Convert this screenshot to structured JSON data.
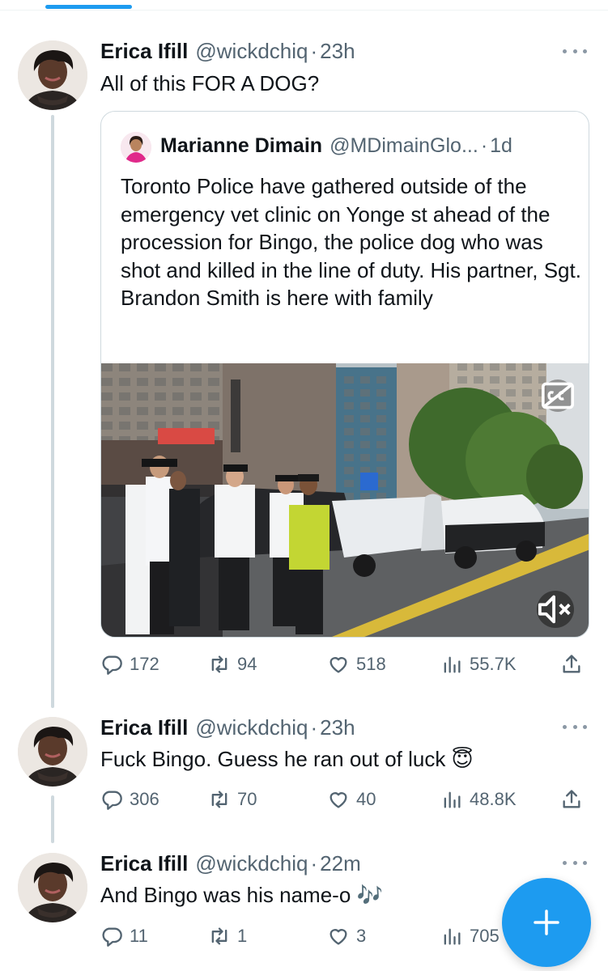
{
  "tweets": [
    {
      "name": "Erica Ifill",
      "handle": "@wickdchiq",
      "time": "23h",
      "text": "All of this FOR A DOG?",
      "stats": {
        "replies": "172",
        "retweets": "94",
        "likes": "518",
        "views": "55.7K"
      }
    },
    {
      "name": "Erica Ifill",
      "handle": "@wickdchiq",
      "time": "23h",
      "text": "Fuck Bingo. Guess he ran out of luck 😇",
      "stats": {
        "replies": "306",
        "retweets": "70",
        "likes": "40",
        "views": "48.8K"
      }
    },
    {
      "name": "Erica Ifill",
      "handle": "@wickdchiq",
      "time": "22m",
      "text": "And Bingo was his name-o 🎶",
      "stats": {
        "replies": "11",
        "retweets": "1",
        "likes": "3",
        "views": "705"
      }
    }
  ],
  "quote": {
    "name": "Marianne Dimain",
    "handle": "@MDimainGlo...",
    "time": "1d",
    "text": "Toronto Police have gathered outside of the emergency vet clinic on Yonge st ahead of the procession for Bingo, the police dog who was shot and killed in the line of duty. His partner, Sgt. Brandon Smith is here with family",
    "media_caption_icon": "cc-icon",
    "media_mute_icon": "mute-icon"
  },
  "separator": "·",
  "colors": {
    "accent": "#1d9bf0",
    "text": "#0f1419",
    "secondary": "#536471",
    "border": "#cfd9de"
  }
}
